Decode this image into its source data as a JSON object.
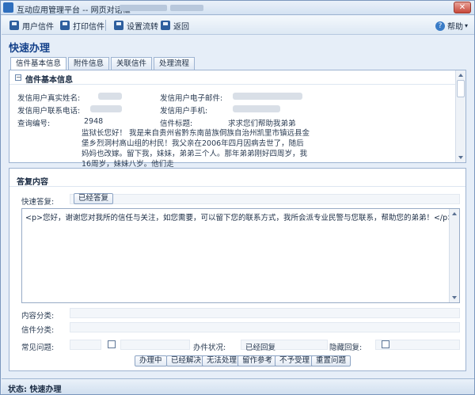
{
  "window": {
    "title": "互动应用管理平台 -- 网页对话框",
    "close_label": "✕"
  },
  "toolbar": {
    "items": [
      {
        "label": "用户信件"
      },
      {
        "label": "打印信件"
      },
      {
        "label": "设置流转"
      },
      {
        "label": "返回"
      }
    ],
    "help_label": "帮助",
    "help_arrow": "▾",
    "help_icon": "?"
  },
  "page": {
    "title": "快速办理"
  },
  "tabs": [
    {
      "label": "信件基本信息"
    },
    {
      "label": "附件信息"
    },
    {
      "label": "关联信件"
    },
    {
      "label": "处理流程"
    }
  ],
  "letter_info": {
    "section_title": "信件基本信息",
    "collapse_glyph": "−",
    "real_name_label": "发信用户真实姓名:",
    "email_label": "发信用户电子邮件:",
    "phone_label": "发信用户联系电话:",
    "mobile_label": "发信用户手机:",
    "query_no_label": "查询编号:",
    "query_no_value": "2948",
    "subject_label": "信件标题:",
    "subject_value": "求求您们帮助我弟弟",
    "content": "监狱长您好！ 我是来自贵州省黔东南苗族侗族自治州凯里市镇远县金堡乡烈洞村高山组的村民！我父亲在2006年四月因病去世了，随后妈妈也改嫁。留下我，妹妹，弟弟三个人。那年弟弟刚好四周岁，我16周岁，妹妹八岁。他们走"
  },
  "reply": {
    "section_title": "答复内容",
    "quick_reply_label": "快速答复:",
    "quick_reply_button": "已经答复",
    "editor_text": "<p>您好，谢谢您对我所的信任与关注，如您需要，可以留下您的联系方式，我所会派专业民警与您联系，帮助您的弟弟！</p>",
    "content_category_label": "内容分类:",
    "letter_category_label": "信件分类:",
    "faq_label": "常见问题:",
    "status_label": "办件状况:",
    "status_value": "已经回复",
    "hide_reply_label": "隐藏回复:",
    "actions": [
      {
        "label": "办理中"
      },
      {
        "label": "已经解决"
      },
      {
        "label": "无法处理"
      },
      {
        "label": "留作参考"
      },
      {
        "label": "不予受理"
      },
      {
        "label": "重置问题"
      }
    ]
  },
  "statusbar": {
    "text": "状态: 快速办理"
  }
}
